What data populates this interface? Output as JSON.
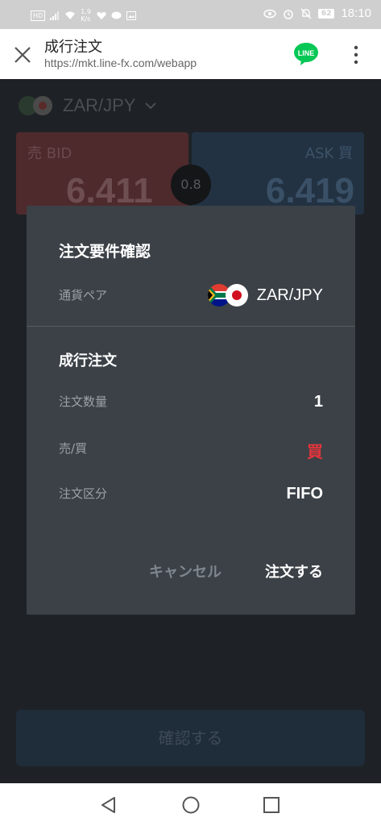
{
  "status_bar": {
    "left_badges": [
      "HD",
      "1.9 K/s"
    ],
    "time": "18:10",
    "battery": "62"
  },
  "browser": {
    "title": "成行注文",
    "url": "https://mkt.line-fx.com/webapp",
    "line_label": "LINE"
  },
  "background_app": {
    "pair": "ZAR/JPY",
    "bid_label": "売 BID",
    "ask_label": "ASK 買",
    "bid_price": "6.411",
    "ask_price": "6.419",
    "spread": "0.8",
    "confirm_button": "確認する"
  },
  "modal": {
    "title": "注文要件確認",
    "pair_label": "通貨ペア",
    "pair_value": "ZAR/JPY",
    "section_title": "成行注文",
    "rows": [
      {
        "label": "注文数量",
        "value": "1"
      },
      {
        "label": "売/買",
        "value": "買"
      },
      {
        "label": "注文区分",
        "value": "FIFO"
      }
    ],
    "cancel": "キャンセル",
    "submit": "注文する"
  },
  "colors": {
    "buy": "#e0353b",
    "modal_bg": "#3b4147",
    "line_green": "#06c755"
  }
}
